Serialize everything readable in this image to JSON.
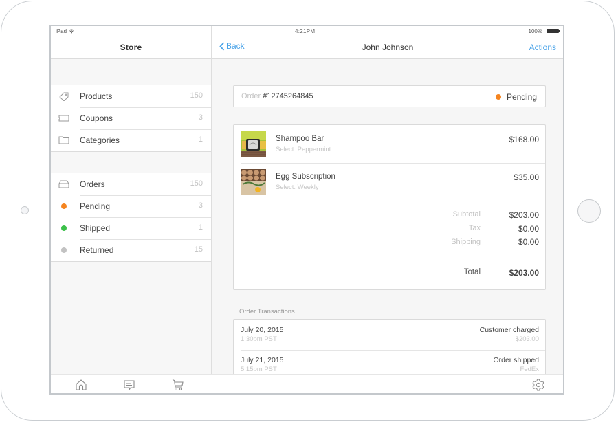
{
  "device": {
    "model": "iPad"
  },
  "status_bar": {
    "carrier": "iPad",
    "wifi_icon": "wifi-icon",
    "time": "4:21PM",
    "battery_percent": "100%",
    "battery_icon": "battery-icon"
  },
  "sidebar": {
    "title": "Store",
    "catalog_items": [
      {
        "label": "Products",
        "count": "150",
        "icon": "tag-icon"
      },
      {
        "label": "Coupons",
        "count": "3",
        "icon": "coupon-icon"
      },
      {
        "label": "Categories",
        "count": "1",
        "icon": "folder-icon"
      }
    ],
    "order_items": [
      {
        "label": "Orders",
        "count": "150",
        "icon": "inbox-icon"
      },
      {
        "label": "Pending",
        "count": "3",
        "icon": "status-dot",
        "color": "#f5841f"
      },
      {
        "label": "Shipped",
        "count": "1",
        "icon": "status-dot",
        "color": "#3cc04a"
      },
      {
        "label": "Returned",
        "count": "15",
        "icon": "status-dot",
        "color": "#c2c2c2"
      }
    ]
  },
  "tabbar": {
    "items": [
      {
        "icon": "home-icon"
      },
      {
        "icon": "message-icon"
      },
      {
        "icon": "cart-icon"
      },
      {
        "icon": "gear-icon"
      }
    ]
  },
  "detail": {
    "back_label": "Back",
    "title": "John Johnson",
    "actions_label": "Actions",
    "order": {
      "label": "Order",
      "number": "#12745264845",
      "status": "Pending",
      "status_color": "#f5841f"
    },
    "items": [
      {
        "name": "Shampoo Bar",
        "variant": "Select: Peppermint",
        "price": "$168.00",
        "thumb": "shampoo-bar-thumbnail"
      },
      {
        "name": "Egg Subscription",
        "variant": "Select: Weekly",
        "price": "$35.00",
        "thumb": "egg-subscription-thumbnail"
      }
    ],
    "summary": {
      "subtotal_label": "Subtotal",
      "subtotal": "$203.00",
      "tax_label": "Tax",
      "tax": "$0.00",
      "shipping_label": "Shipping",
      "shipping": "$0.00",
      "total_label": "Total",
      "total": "$203.00"
    },
    "transactions_heading": "Order Transactions",
    "transactions": [
      {
        "date": "July 20, 2015",
        "time": "1:30pm PST",
        "event": "Customer charged",
        "meta": "$203.00"
      },
      {
        "date": "July 21, 2015",
        "time": "5:15pm PST",
        "event": "Order shipped",
        "meta": "FedEx"
      }
    ]
  },
  "colors": {
    "accent": "#4aa3e8",
    "pending": "#f5841f",
    "shipped": "#3cc04a",
    "returned": "#c2c2c2"
  }
}
